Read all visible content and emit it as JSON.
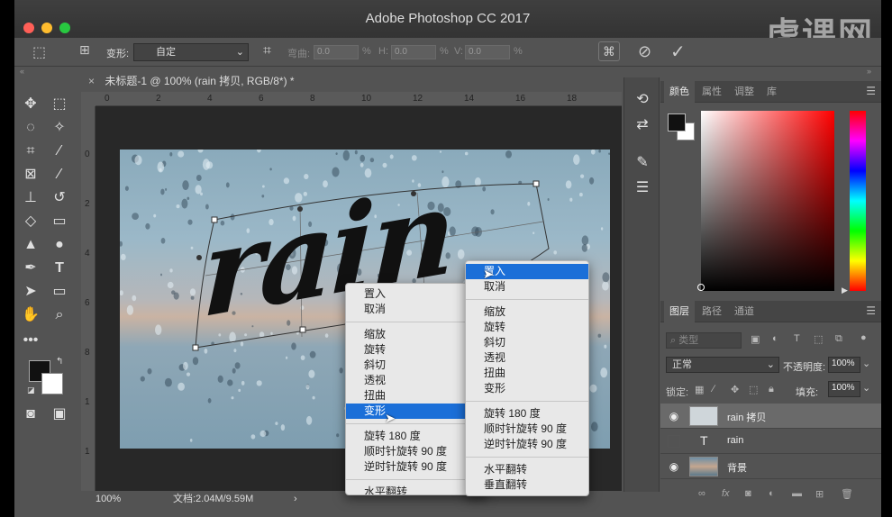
{
  "app": {
    "window_title": "Adobe Photoshop CC 2017",
    "watermark": "虎课网"
  },
  "options_bar": {
    "transform_label": "变形:",
    "transform_value": "自定",
    "bend_label": "弯曲:",
    "bend_value": "0.0",
    "h_label": "H:",
    "h_value": "0.0",
    "v_label": "V:",
    "v_value": "0.0",
    "percent": "%"
  },
  "document": {
    "tab_title": "未标题-1 @ 100% (rain 拷贝, RGB/8*) *",
    "zoom": "100%",
    "doc_size": "文档:2.04M/9.59M",
    "canvas_text": "rain",
    "ruler_h": [
      "0",
      "2",
      "4",
      "6",
      "8",
      "10",
      "12",
      "14",
      "16",
      "18"
    ],
    "ruler_v": [
      "0",
      "2",
      "4",
      "6",
      "8",
      "1",
      "1",
      "2"
    ]
  },
  "context_menu_1": {
    "items": [
      {
        "label": "置入",
        "state": "normal"
      },
      {
        "label": "取消",
        "state": "normal"
      },
      {
        "label": "缩放",
        "state": "normal"
      },
      {
        "label": "旋转",
        "state": "normal"
      },
      {
        "label": "斜切",
        "state": "normal"
      },
      {
        "label": "透视",
        "state": "normal"
      },
      {
        "label": "扭曲",
        "state": "normal"
      },
      {
        "label": "变形",
        "state": "highlighted"
      },
      {
        "label": "旋转 180 度",
        "state": "normal"
      },
      {
        "label": "顺时针旋转 90 度",
        "state": "normal"
      },
      {
        "label": "逆时针旋转 90 度",
        "state": "normal"
      },
      {
        "label": "水平翻转",
        "state": "normal"
      }
    ]
  },
  "context_menu_2": {
    "items": [
      {
        "label": "置入",
        "state": "highlighted"
      },
      {
        "label": "取消",
        "state": "normal"
      },
      {
        "label": "缩放",
        "state": "normal"
      },
      {
        "label": "旋转",
        "state": "normal"
      },
      {
        "label": "斜切",
        "state": "normal"
      },
      {
        "label": "透视",
        "state": "normal"
      },
      {
        "label": "扭曲",
        "state": "normal"
      },
      {
        "label": "变形",
        "state": "normal"
      },
      {
        "label": "旋转 180 度",
        "state": "normal"
      },
      {
        "label": "顺时针旋转 90 度",
        "state": "normal"
      },
      {
        "label": "逆时针旋转 90 度",
        "state": "normal"
      },
      {
        "label": "水平翻转",
        "state": "normal"
      },
      {
        "label": "垂直翻转",
        "state": "normal"
      }
    ]
  },
  "color_panel": {
    "tabs": [
      "颜色",
      "属性",
      "调整",
      "库"
    ],
    "foreground": "#111111",
    "background": "#ffffff",
    "picker_hue": "#ff0000"
  },
  "layers_panel": {
    "tabs": [
      "图层",
      "路径",
      "通道"
    ],
    "filter_placeholder": "类型",
    "blend_mode": "正常",
    "opacity_label": "不透明度:",
    "opacity_value": "100%",
    "lock_label": "锁定:",
    "fill_label": "填充:",
    "fill_value": "100%",
    "layers": [
      {
        "name": "rain 拷贝",
        "visible": true,
        "selected": true,
        "kind": "smart"
      },
      {
        "name": "rain",
        "visible": false,
        "selected": false,
        "kind": "text"
      },
      {
        "name": "背景",
        "visible": true,
        "selected": false,
        "kind": "image"
      }
    ]
  },
  "colors": {
    "menu_highlight": "#1b6fd8",
    "ui_bg": "#535353",
    "traffic_red": "#ff5f57",
    "traffic_yellow": "#febc2e",
    "traffic_green": "#28c840"
  }
}
